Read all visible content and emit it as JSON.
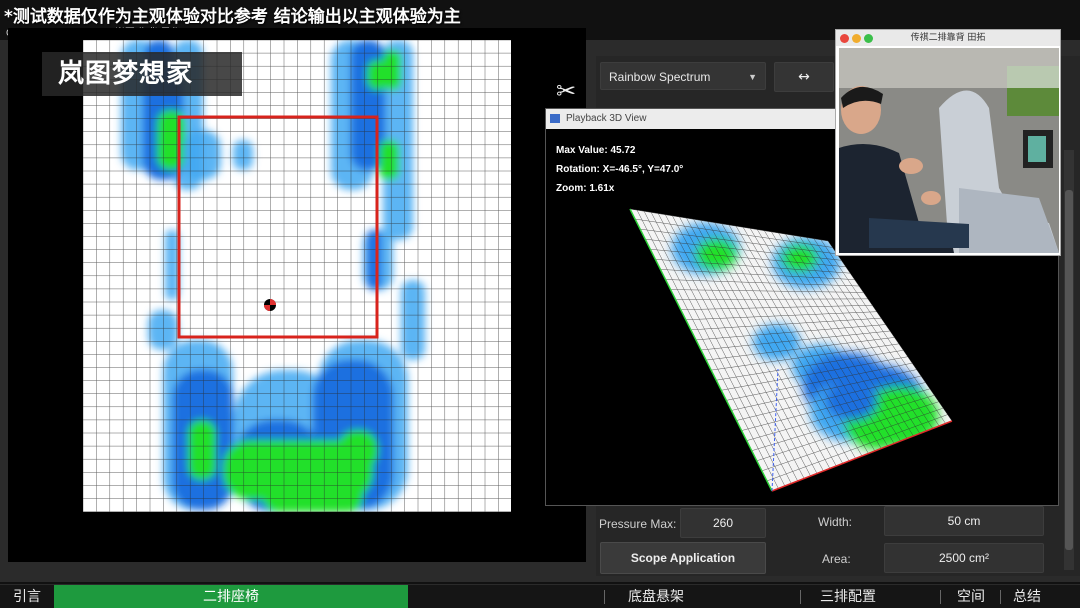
{
  "overlay": {
    "disclaimer": "*测试数据仅作为主观体验对比参考 结论输出以主观体验为主",
    "file_path": "C:/Users/brady/Desktop/岚图 靠背 恩华.dat/zz-1500.csv//",
    "watermark": "岚图梦想家"
  },
  "controls": {
    "color_map": "Rainbow Spectrum",
    "arrow_button": "↔",
    "pressure_max_label": "Pressure Max:",
    "pressure_max_value": "260",
    "scope_button": "Scope Application",
    "width_label": "Width:",
    "width_value": "50 cm",
    "area_label": "Area:",
    "area_value": "2500 cm²"
  },
  "view3d": {
    "title": "Playback 3D View",
    "max_value": "Max Value: 45.72",
    "rotation": "Rotation: X=-46.5°, Y=47.0°",
    "zoom": "Zoom: 1.61x"
  },
  "video": {
    "title": "传祺二排靠背 田拓"
  },
  "nav": {
    "items": [
      "引言",
      "二排座椅",
      "底盘悬架",
      "三排配置",
      "空间",
      "总结"
    ],
    "active_index": 1
  },
  "colors": {
    "active_tab": "#1e9a3e",
    "heat_green": "#22e02a",
    "heat_blue": "#1d6fe0",
    "heat_light_blue": "#3fa8f2",
    "scope_box": "#d8231c"
  }
}
